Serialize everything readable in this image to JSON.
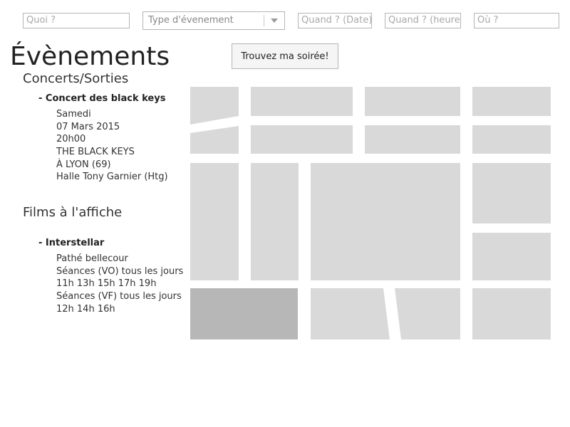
{
  "search": {
    "what_placeholder": "Quoi ?",
    "type_placeholder": "Type d'évenement",
    "date_placeholder": "Quand ? (Date)",
    "time_placeholder": "Quand ? (heure)",
    "where_placeholder": "Où ?"
  },
  "page_title": "Évènements",
  "find_button_label": "Trouvez ma soirée!",
  "concerts": {
    "heading": "Concerts/Sorties",
    "event_title": "- Concert des black keys",
    "details": [
      "Samedi",
      "07 Mars 2015",
      "20h00",
      "THE BLACK KEYS",
      "À LYON (69)",
      "Halle Tony Garnier (Htg)"
    ]
  },
  "films": {
    "heading": "Films à l'affiche",
    "event_title": "- Interstellar",
    "details": [
      "Pathé bellecour",
      "Séances (VO) tous les jours",
      "11h 13h 15h 17h 19h",
      "Séances (VF) tous les jours",
      "12h 14h 16h"
    ]
  },
  "map": {
    "block_color": "#d9d9d9",
    "highlight_color": "#b7b7b7",
    "street_color": "#ffffff"
  }
}
